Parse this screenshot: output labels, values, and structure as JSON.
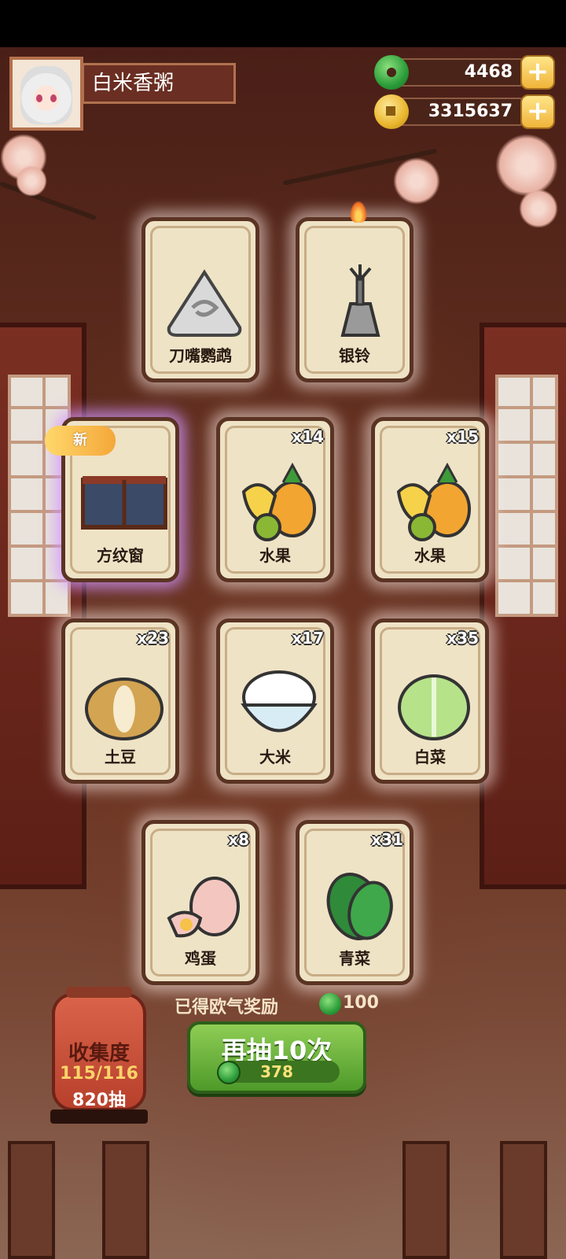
{
  "player": {
    "name": "白米香粥"
  },
  "currency": {
    "jade": "4468",
    "coins": "3315637",
    "plus_symbol": "+"
  },
  "cards": [
    {
      "id": "c1",
      "label": "刀嘴鹦鹉",
      "count": ""
    },
    {
      "id": "c2",
      "label": "银铃",
      "count": ""
    },
    {
      "id": "c3",
      "label": "方纹窗",
      "count": "",
      "badge": "新"
    },
    {
      "id": "c4",
      "label": "水果",
      "count": "x14"
    },
    {
      "id": "c5",
      "label": "水果",
      "count": "x15"
    },
    {
      "id": "c6",
      "label": "土豆",
      "count": "x23"
    },
    {
      "id": "c7",
      "label": "大米",
      "count": "x17"
    },
    {
      "id": "c8",
      "label": "白菜",
      "count": "x35"
    },
    {
      "id": "c9",
      "label": "鸡蛋",
      "count": "x8"
    },
    {
      "id": "c10",
      "label": "青菜",
      "count": "x31"
    }
  ],
  "reward": {
    "label": "已得欧气奖励",
    "value": "100"
  },
  "draw_button": {
    "label": "再抽10次",
    "cost": "378"
  },
  "collection": {
    "title": "收集度",
    "progress": "115/116",
    "draws": "820抽"
  },
  "colors": {
    "card_bg": "#efe3c6",
    "button_green": "#6fb640",
    "accent_gold": "#f0b43a"
  }
}
